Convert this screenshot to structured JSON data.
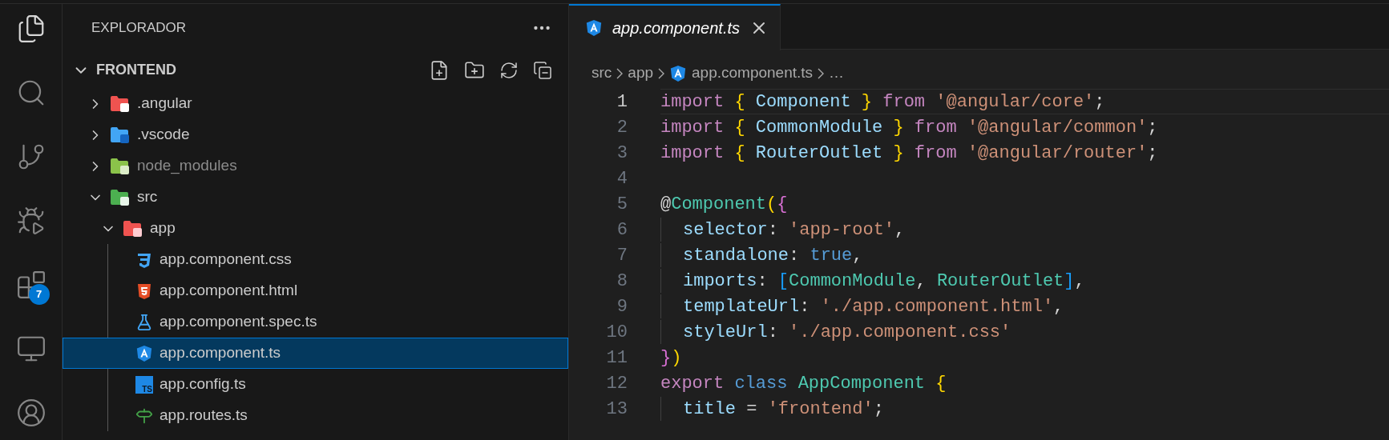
{
  "activity_bar": [
    {
      "kind": "files",
      "selected": true
    },
    {
      "kind": "search",
      "selected": false
    },
    {
      "kind": "scm",
      "selected": false
    },
    {
      "kind": "debug",
      "selected": false
    },
    {
      "kind": "extensions",
      "selected": false,
      "badge": "7"
    },
    {
      "kind": "remote",
      "selected": false
    },
    {
      "kind": "account",
      "selected": false
    }
  ],
  "explorer": {
    "title": "EXPLORADOR",
    "root": {
      "label": "FRONTEND",
      "expanded": true,
      "children": [
        {
          "label": ".angular",
          "kind": "angularfolder",
          "expanded": false,
          "selected": false,
          "dimmed": false
        },
        {
          "label": ".vscode",
          "kind": "vscodefolder",
          "expanded": false,
          "selected": false,
          "dimmed": false
        },
        {
          "label": "node_modules",
          "kind": "nodefolder",
          "expanded": false,
          "selected": false,
          "dimmed": true
        },
        {
          "label": "src",
          "kind": "srcfolder",
          "expanded": true,
          "selected": false,
          "dimmed": false,
          "children": [
            {
              "label": "app",
              "kind": "appfolder",
              "expanded": true,
              "selected": false,
              "dimmed": false,
              "children": [
                {
                  "label": "app.component.css",
                  "kind": "css",
                  "selected": false,
                  "dimmed": false
                },
                {
                  "label": "app.component.html",
                  "kind": "html",
                  "selected": false,
                  "dimmed": false
                },
                {
                  "label": "app.component.spec.ts",
                  "kind": "test",
                  "selected": false,
                  "dimmed": false
                },
                {
                  "label": "app.component.ts",
                  "kind": "angular",
                  "selected": true,
                  "dimmed": false
                },
                {
                  "label": "app.config.ts",
                  "kind": "ts",
                  "icon_text": "TS",
                  "selected": false,
                  "dimmed": false
                },
                {
                  "label": "app.routes.ts",
                  "kind": "routes",
                  "selected": false,
                  "dimmed": false
                }
              ]
            }
          ]
        }
      ]
    }
  },
  "tabs": [
    {
      "label": "app.component.ts",
      "kind": "angular",
      "selected": true,
      "preview": true
    }
  ],
  "breadcrumbs": [
    {
      "label": "src",
      "kind": "folder"
    },
    {
      "label": "app",
      "kind": "folder"
    },
    {
      "label": "app.component.ts",
      "kind": "angular"
    },
    {
      "label": "…",
      "kind": "symbol"
    }
  ],
  "code": [
    {
      "number": "1",
      "current": true,
      "guide": false,
      "tokens": [
        {
          "kind": "keyword",
          "text": "import "
        },
        {
          "kind": "brace1",
          "text": "{"
        },
        {
          "kind": "var",
          "text": " Component "
        },
        {
          "kind": "brace1",
          "text": "}"
        },
        {
          "kind": "keyword",
          "text": " from "
        },
        {
          "kind": "string",
          "text": "'@angular/core'"
        },
        {
          "kind": "punct",
          "text": ";"
        }
      ]
    },
    {
      "number": "2",
      "current": false,
      "guide": false,
      "tokens": [
        {
          "kind": "keyword",
          "text": "import "
        },
        {
          "kind": "brace1",
          "text": "{"
        },
        {
          "kind": "var",
          "text": " CommonModule "
        },
        {
          "kind": "brace1",
          "text": "}"
        },
        {
          "kind": "keyword",
          "text": " from "
        },
        {
          "kind": "string",
          "text": "'@angular/common'"
        },
        {
          "kind": "punct",
          "text": ";"
        }
      ]
    },
    {
      "number": "3",
      "current": false,
      "guide": false,
      "tokens": [
        {
          "kind": "keyword",
          "text": "import "
        },
        {
          "kind": "brace1",
          "text": "{"
        },
        {
          "kind": "var",
          "text": " RouterOutlet "
        },
        {
          "kind": "brace1",
          "text": "}"
        },
        {
          "kind": "keyword",
          "text": " from "
        },
        {
          "kind": "string",
          "text": "'@angular/router'"
        },
        {
          "kind": "punct",
          "text": ";"
        }
      ]
    },
    {
      "number": "4",
      "current": false,
      "guide": false
    },
    {
      "number": "5",
      "current": false,
      "guide": false,
      "tokens": [
        {
          "kind": "punct",
          "text": "@"
        },
        {
          "kind": "type",
          "text": "Component"
        },
        {
          "kind": "brace1",
          "text": "("
        },
        {
          "kind": "brace2",
          "text": "{"
        }
      ]
    },
    {
      "number": "6",
      "current": false,
      "guide": true,
      "tokens": [
        {
          "kind": "var",
          "text": "selector"
        },
        {
          "kind": "punct",
          "text": ": "
        },
        {
          "kind": "string",
          "text": "'app-root'"
        },
        {
          "kind": "punct",
          "text": ","
        }
      ]
    },
    {
      "number": "7",
      "current": false,
      "guide": true,
      "tokens": [
        {
          "kind": "var",
          "text": "standalone"
        },
        {
          "kind": "punct",
          "text": ": "
        },
        {
          "kind": "storage",
          "text": "true"
        },
        {
          "kind": "punct",
          "text": ","
        }
      ]
    },
    {
      "number": "8",
      "current": false,
      "guide": true,
      "tokens": [
        {
          "kind": "var",
          "text": "imports"
        },
        {
          "kind": "punct",
          "text": ": "
        },
        {
          "kind": "brace3",
          "text": "["
        },
        {
          "kind": "type",
          "text": "CommonModule"
        },
        {
          "kind": "punct",
          "text": ", "
        },
        {
          "kind": "type",
          "text": "RouterOutlet"
        },
        {
          "kind": "brace3",
          "text": "]"
        },
        {
          "kind": "punct",
          "text": ","
        }
      ]
    },
    {
      "number": "9",
      "current": false,
      "guide": true,
      "tokens": [
        {
          "kind": "var",
          "text": "templateUrl"
        },
        {
          "kind": "punct",
          "text": ": "
        },
        {
          "kind": "string",
          "text": "'./app.component.html'"
        },
        {
          "kind": "punct",
          "text": ","
        }
      ]
    },
    {
      "number": "10",
      "current": false,
      "guide": true,
      "tokens": [
        {
          "kind": "var",
          "text": "styleUrl"
        },
        {
          "kind": "punct",
          "text": ": "
        },
        {
          "kind": "string",
          "text": "'./app.component.css'"
        }
      ]
    },
    {
      "number": "11",
      "current": false,
      "guide": false,
      "tokens": [
        {
          "kind": "brace2",
          "text": "}"
        },
        {
          "kind": "brace1",
          "text": ")"
        }
      ]
    },
    {
      "number": "12",
      "current": false,
      "guide": false,
      "tokens": [
        {
          "kind": "keyword",
          "text": "export "
        },
        {
          "kind": "storage",
          "text": "class "
        },
        {
          "kind": "type",
          "text": "AppComponent "
        },
        {
          "kind": "brace1",
          "text": "{"
        }
      ]
    },
    {
      "number": "13",
      "current": false,
      "guide": true,
      "tokens": [
        {
          "kind": "var",
          "text": "title"
        },
        {
          "kind": "punct",
          "text": " = "
        },
        {
          "kind": "string",
          "text": "'frontend'"
        },
        {
          "kind": "punct",
          "text": ";"
        }
      ]
    }
  ]
}
